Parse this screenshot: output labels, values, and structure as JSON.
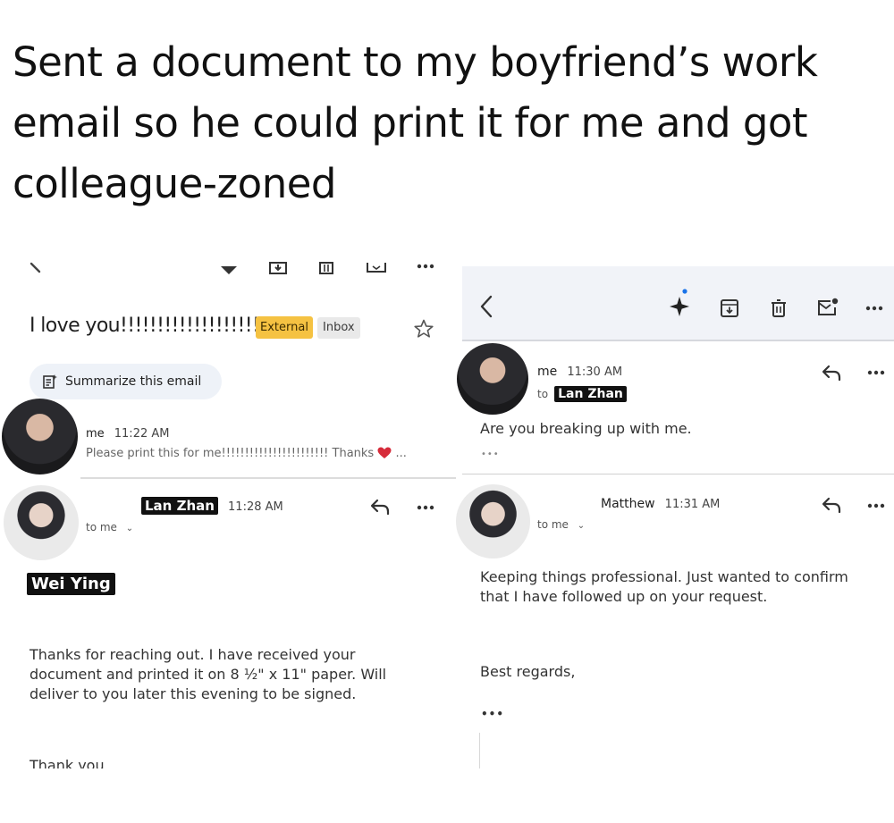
{
  "caption": {
    "line1": "Sent a document to my boyfriend’s work",
    "line2": "email so he could print it for me and got",
    "line3": "colleague-zoned"
  },
  "left": {
    "subject": "I love you!!!!!!!!!!!!!!!!!!!!!!!!!",
    "badge_external": "External",
    "badge_inbox": "Inbox",
    "summarize_label": "Summarize this email",
    "msg1": {
      "sender": "me",
      "time": "11:22 AM",
      "snippet": "Please print this for me!!!!!!!!!!!!!!!!!!!!!!! Thanks",
      "ellipsis": "..."
    },
    "msg2": {
      "sender": "Lan Zhan",
      "time": "11:28 AM",
      "to": "to me",
      "name_tag": "Wei Ying",
      "body_line1": "Thanks for reaching out. I have received your",
      "body_line2": "document and printed it on 8 ½\" x 11\" paper. Will",
      "body_line3": "deliver to you later this evening to be signed.",
      "signoff": "Thank you"
    }
  },
  "right": {
    "msg1": {
      "sender": "me",
      "time": "11:30 AM",
      "to_prefix": "to",
      "to_name": "Lan Zhan",
      "body": "Are you breaking up with me.",
      "more": "•••"
    },
    "msg2": {
      "sender": "Matthew",
      "time": "11:31 AM",
      "to": "to me",
      "body_line1": "Keeping things professional. Just wanted to confirm",
      "body_line2": "that I have followed up on your request.",
      "regards": "Best regards,",
      "more": "•••"
    }
  },
  "colors": {
    "external_badge": "#f5c242",
    "heart": "#d62b3a",
    "toolbar_bg": "#f1f3f8",
    "sparkle_dot": "#1a73e8"
  },
  "icons": [
    "back-icon",
    "archive-icon",
    "delete-icon",
    "mark-unread-icon",
    "more-icon",
    "star-icon",
    "summarize-icon",
    "reply-icon",
    "sparkle-icon",
    "heart-icon"
  ]
}
